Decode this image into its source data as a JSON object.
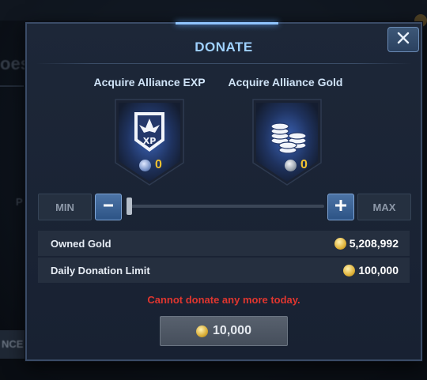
{
  "dialog": {
    "title": "DONATE",
    "close_icon": "close-icon"
  },
  "options": [
    {
      "title": "Acquire Alliance EXP",
      "icon": "alliance-exp-shield-icon",
      "currency_icon": "crystal-icon",
      "count": "0"
    },
    {
      "title": "Acquire Alliance Gold",
      "icon": "gold-coins-stack-icon",
      "currency_icon": "silver-coin-icon",
      "count": "0"
    }
  ],
  "slider": {
    "min_label": "MIN",
    "max_label": "MAX",
    "decrease_icon": "minus-icon",
    "increase_icon": "plus-icon",
    "value_fraction": 0
  },
  "info": [
    {
      "label": "Owned Gold",
      "icon": "gold-coin-icon",
      "value": "5,208,992"
    },
    {
      "label": "Daily Donation Limit",
      "icon": "gold-coin-icon",
      "value": "100,000"
    }
  ],
  "warning": "Cannot donate any more today.",
  "donate_button": {
    "icon": "gold-coin-icon",
    "amount": "10,000"
  },
  "background": {
    "left_fragment": "oes",
    "bottom_left_fragment": "NCE M",
    "right_fragment_p": "P"
  },
  "colors": {
    "accent_title": "#9fd1ff",
    "warning": "#e0362f",
    "currency_count": "#f2c230"
  }
}
